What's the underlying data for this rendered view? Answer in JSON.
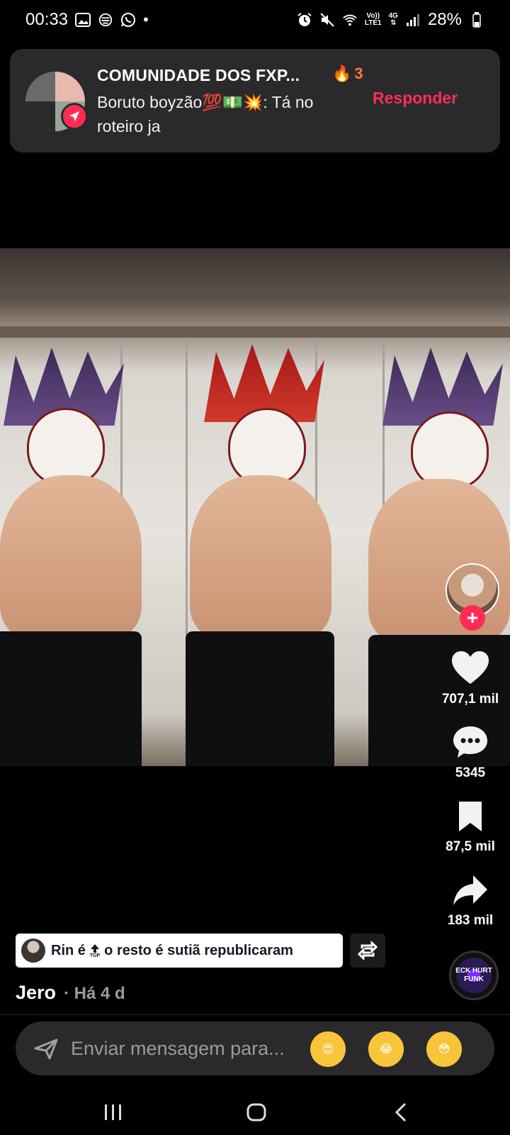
{
  "status_bar": {
    "time": "00:33",
    "network_volte": "Vo))",
    "network_lte": "LTE1",
    "network_4g": "4G",
    "battery": "28%"
  },
  "notification": {
    "title": "COMUNIDADE DOS FXP...",
    "streak_count": "3",
    "sender": "Boruto boyzão💯💵💥",
    "message": ": Tá no roteiro ja",
    "reply_label": "Responder"
  },
  "actions": {
    "likes": "707,1 mil",
    "comments": "5345",
    "saves": "87,5 mil",
    "shares": "183 mil"
  },
  "music_disc_text": "ECK HURT FUNK",
  "repost": {
    "user": "Rin é",
    "top_label": "TOP",
    "rest": "o resto é sutiã republicaram"
  },
  "author": {
    "name": "Jero",
    "time": "· Há 4 d"
  },
  "message_bar": {
    "placeholder": "Enviar mensagem para...",
    "emojis": [
      "😍",
      "😂",
      "😳"
    ]
  },
  "colors": {
    "accent": "#ff2d55",
    "fire": "#ff7a35",
    "notification_bg": "#2a2a2d"
  }
}
